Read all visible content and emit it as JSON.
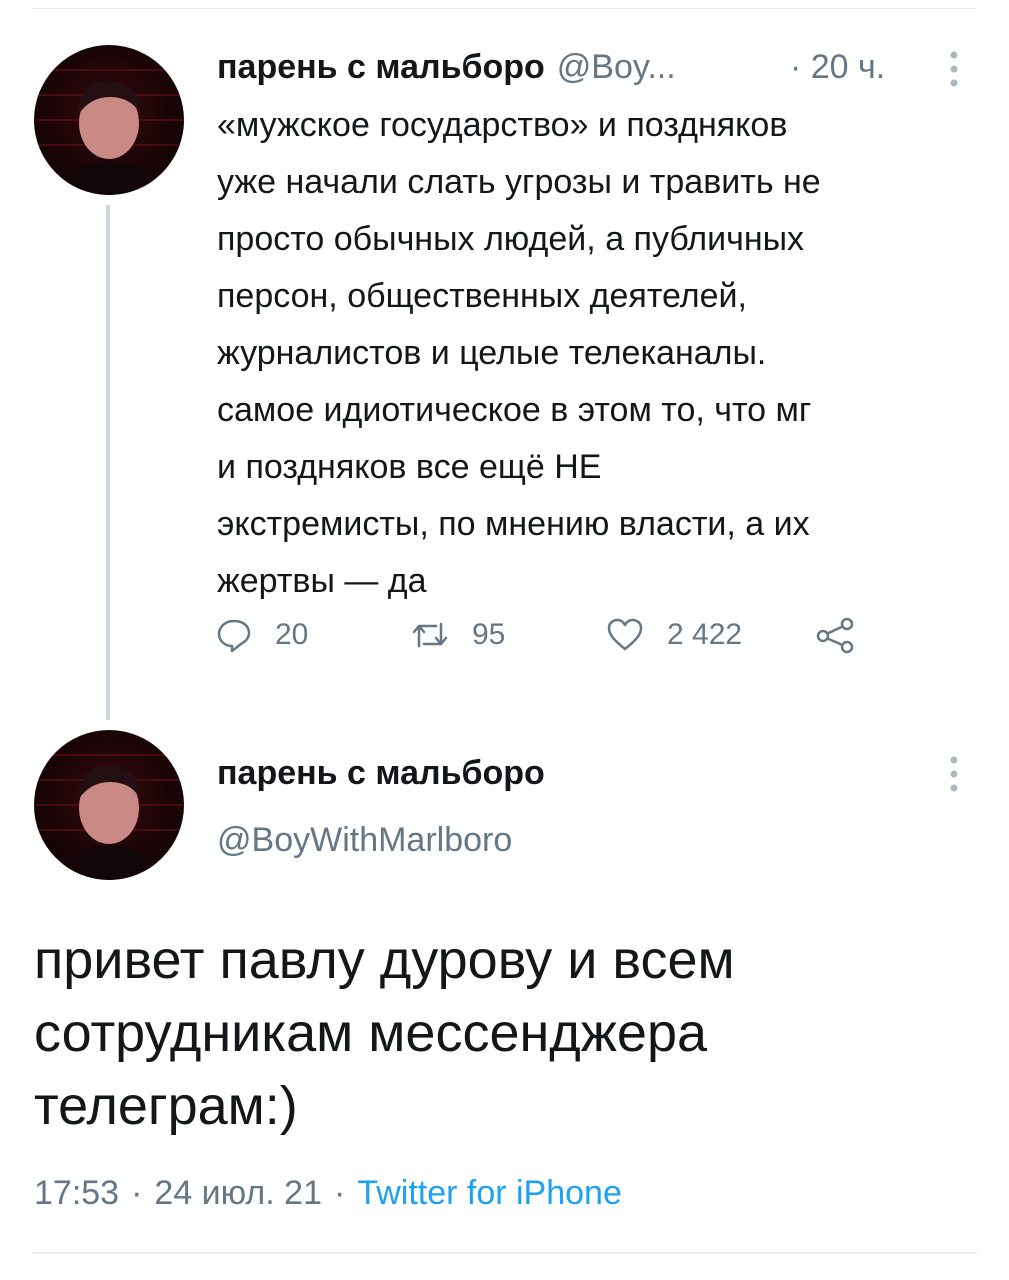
{
  "reply_tweet": {
    "author_name": "парень с мальборо",
    "handle": "@Boy...",
    "time": "· 20 ч.",
    "text": "«мужское государство» и поздняков\nуже начали слать угрозы и травить не\nпросто обычных людей, а публичных\nперсон, общественных деятелей,\nжурналистов и целые телеканалы.\nсамое идиотическое в этом то, что мг\nи поздняков все ещё НЕ\nэкстремисты, по мнению власти, а их\nжертвы — да",
    "replies": "20",
    "retweets": "95",
    "likes": "2 422"
  },
  "main_tweet": {
    "author_name": "парень с мальборо",
    "handle": "@BoyWithMarlboro",
    "text": "привет павлу дурову и всем\nсотрудникам мессенджера\nтелеграм:)",
    "time": "17:53",
    "date": "24 июл. 21",
    "separator": "·",
    "source": "Twitter for iPhone"
  },
  "icons": [
    "reply-icon",
    "retweet-icon",
    "like-icon",
    "share-icon",
    "more-icon",
    "avatar"
  ],
  "colors": {
    "text": "#14171a",
    "secondary": "#657786",
    "link": "#1da1f2",
    "divider": "#e6ecf0",
    "thread_line": "#ccd6dd"
  }
}
